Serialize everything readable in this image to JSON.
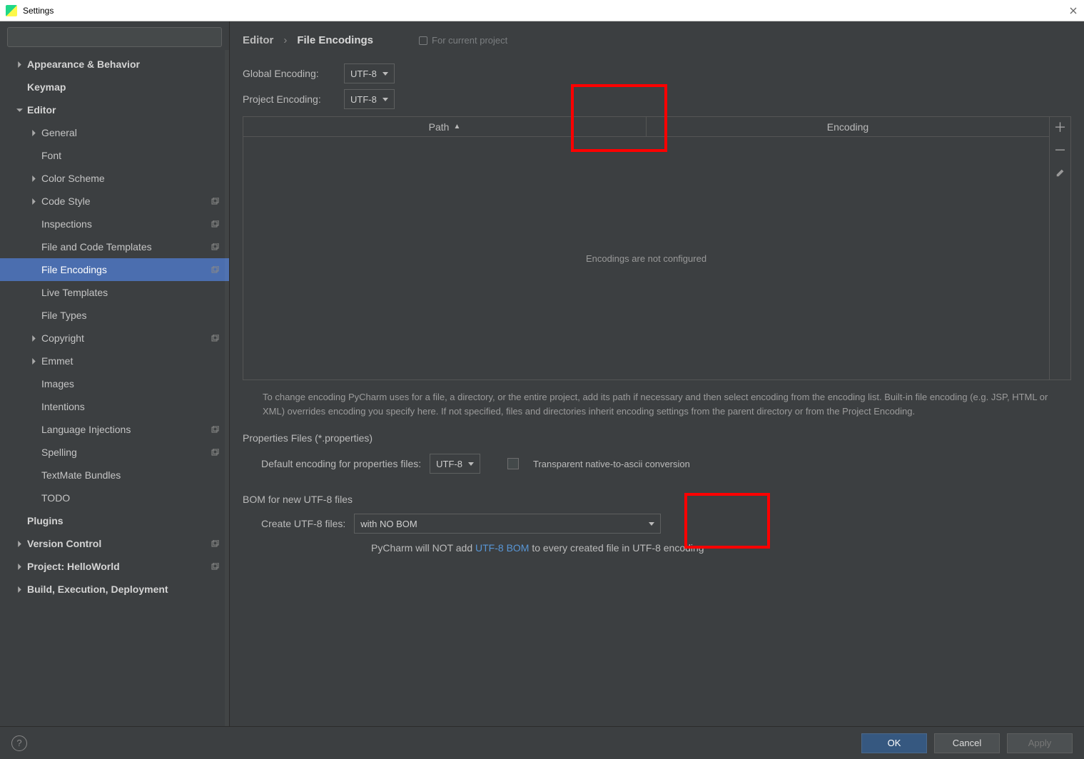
{
  "window": {
    "title": "Settings"
  },
  "search": {
    "placeholder": ""
  },
  "sidebar": {
    "items": [
      {
        "label": "Appearance & Behavior",
        "level": 0,
        "bold": true,
        "arrow": "right"
      },
      {
        "label": "Keymap",
        "level": 0,
        "bold": true,
        "arrow": "none"
      },
      {
        "label": "Editor",
        "level": 0,
        "bold": true,
        "arrow": "down"
      },
      {
        "label": "General",
        "level": 1,
        "arrow": "right"
      },
      {
        "label": "Font",
        "level": 1,
        "arrow": "none"
      },
      {
        "label": "Color Scheme",
        "level": 1,
        "arrow": "right"
      },
      {
        "label": "Code Style",
        "level": 1,
        "arrow": "right",
        "copy": true
      },
      {
        "label": "Inspections",
        "level": 1,
        "arrow": "none",
        "copy": true
      },
      {
        "label": "File and Code Templates",
        "level": 1,
        "arrow": "none",
        "copy": true
      },
      {
        "label": "File Encodings",
        "level": 1,
        "arrow": "none",
        "copy": true,
        "selected": true
      },
      {
        "label": "Live Templates",
        "level": 1,
        "arrow": "none"
      },
      {
        "label": "File Types",
        "level": 1,
        "arrow": "none"
      },
      {
        "label": "Copyright",
        "level": 1,
        "arrow": "right",
        "copy": true
      },
      {
        "label": "Emmet",
        "level": 1,
        "arrow": "right"
      },
      {
        "label": "Images",
        "level": 1,
        "arrow": "none"
      },
      {
        "label": "Intentions",
        "level": 1,
        "arrow": "none"
      },
      {
        "label": "Language Injections",
        "level": 1,
        "arrow": "none",
        "copy": true
      },
      {
        "label": "Spelling",
        "level": 1,
        "arrow": "none",
        "copy": true
      },
      {
        "label": "TextMate Bundles",
        "level": 1,
        "arrow": "none"
      },
      {
        "label": "TODO",
        "level": 1,
        "arrow": "none"
      },
      {
        "label": "Plugins",
        "level": 0,
        "bold": true,
        "arrow": "none"
      },
      {
        "label": "Version Control",
        "level": 0,
        "bold": true,
        "arrow": "right",
        "copy": true
      },
      {
        "label": "Project: HelloWorld",
        "level": 0,
        "bold": true,
        "arrow": "right",
        "copy": true
      },
      {
        "label": "Build, Execution, Deployment",
        "level": 0,
        "bold": true,
        "arrow": "right"
      }
    ]
  },
  "crumbs": {
    "root": "Editor",
    "leaf": "File Encodings",
    "scope": "For current project"
  },
  "enc": {
    "global_label": "Global Encoding:",
    "global_value": "UTF-8",
    "project_label": "Project Encoding:",
    "project_value": "UTF-8"
  },
  "table": {
    "col_path": "Path",
    "col_enc": "Encoding",
    "empty": "Encodings are not configured"
  },
  "help": "To change encoding PyCharm uses for a file, a directory, or the entire project, add its path if necessary and then select encoding from the encoding list. Built-in file encoding (e.g. JSP, HTML or XML) overrides encoding you specify here. If not specified, files and directories inherit encoding settings from the parent directory or from the Project Encoding.",
  "props": {
    "section": "Properties Files (*.properties)",
    "label": "Default encoding for properties files:",
    "value": "UTF-8",
    "checkbox_label": "Transparent native-to-ascii conversion"
  },
  "bom": {
    "section": "BOM for new UTF-8 files",
    "label": "Create UTF-8 files:",
    "value": "with NO BOM",
    "note_pre": "PyCharm will NOT add ",
    "note_link": "UTF-8 BOM",
    "note_post": " to every created file in UTF-8 encoding"
  },
  "footer": {
    "ok": "OK",
    "cancel": "Cancel",
    "apply": "Apply"
  }
}
